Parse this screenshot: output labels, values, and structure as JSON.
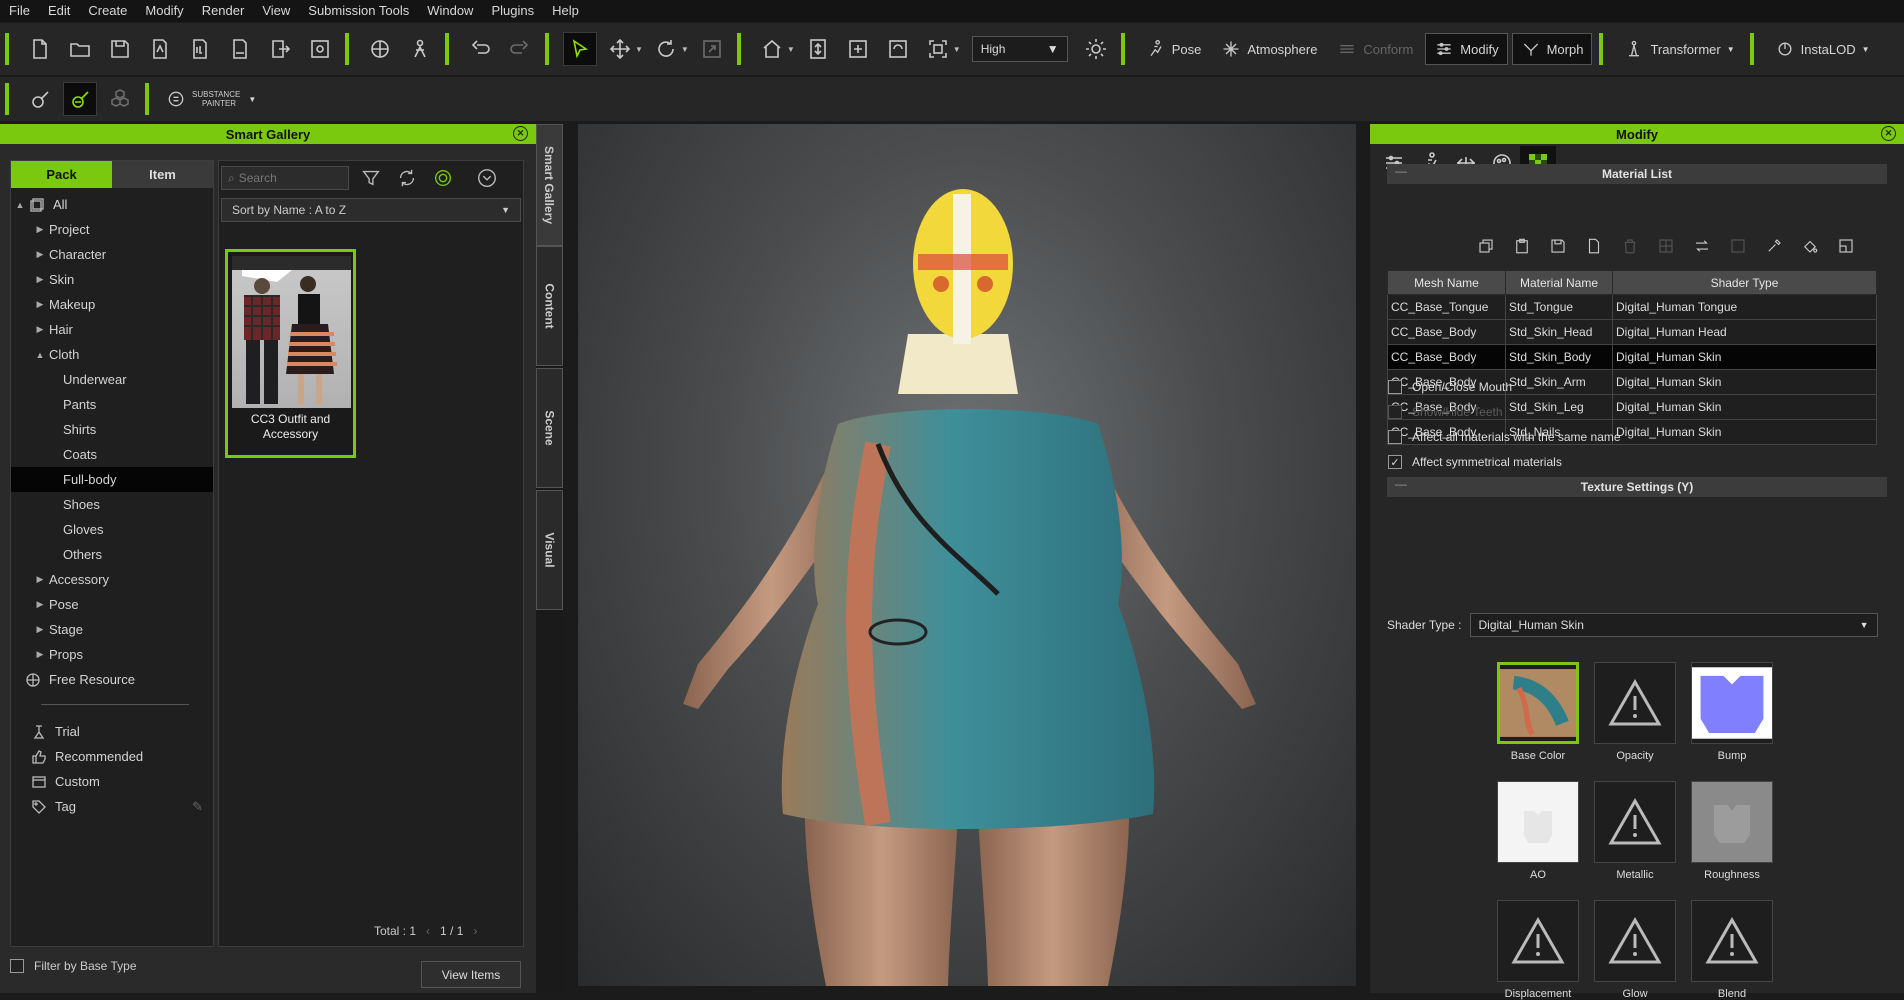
{
  "menu": [
    "File",
    "Edit",
    "Create",
    "Modify",
    "Render",
    "View",
    "Submission Tools",
    "Window",
    "Plugins",
    "Help"
  ],
  "toolbar": {
    "quality": "High",
    "pose_label": "Pose",
    "atmosphere_label": "Atmosphere",
    "conform_label": "Conform",
    "modify_label": "Modify",
    "morph_label": "Morph",
    "transformer_label": "Transformer",
    "instalod_label": "InstaLOD",
    "substance_label_1": "SUBSTANCE",
    "substance_label_2": "PAINTER"
  },
  "gallery": {
    "title": "Smart Gallery",
    "tabs": [
      "Pack",
      "Item"
    ],
    "tree": [
      {
        "label": "All",
        "level": 0,
        "arrow": "▲"
      },
      {
        "label": "Project",
        "level": 1,
        "arrow": "▶"
      },
      {
        "label": "Character",
        "level": 1,
        "arrow": "▶"
      },
      {
        "label": "Skin",
        "level": 1,
        "arrow": "▶"
      },
      {
        "label": "Makeup",
        "level": 1,
        "arrow": "▶"
      },
      {
        "label": "Hair",
        "level": 1,
        "arrow": "▶"
      },
      {
        "label": "Cloth",
        "level": 1,
        "arrow": "▲"
      },
      {
        "label": "Underwear",
        "level": 2,
        "arrow": ""
      },
      {
        "label": "Pants",
        "level": 2,
        "arrow": ""
      },
      {
        "label": "Shirts",
        "level": 2,
        "arrow": ""
      },
      {
        "label": "Coats",
        "level": 2,
        "arrow": ""
      },
      {
        "label": "Full-body",
        "level": 2,
        "arrow": "",
        "selected": true
      },
      {
        "label": "Shoes",
        "level": 2,
        "arrow": ""
      },
      {
        "label": "Gloves",
        "level": 2,
        "arrow": ""
      },
      {
        "label": "Others",
        "level": 2,
        "arrow": ""
      },
      {
        "label": "Accessory",
        "level": 1,
        "arrow": "▶"
      },
      {
        "label": "Pose",
        "level": 1,
        "arrow": "▶"
      },
      {
        "label": "Stage",
        "level": 1,
        "arrow": "▶"
      },
      {
        "label": "Props",
        "level": 1,
        "arrow": "▶"
      },
      {
        "label": "Free Resource",
        "level": 0,
        "arrow": ""
      }
    ],
    "collections": [
      "Trial",
      "Recommended",
      "Custom",
      "Tag"
    ],
    "search_placeholder": "Search",
    "sort": "Sort by Name : A to Z",
    "item_title": "CC3 Outfit and Accessory",
    "total": "Total : 1",
    "page": "1 / 1",
    "filter_label": "Filter by Base Type",
    "view_items": "View Items",
    "side_tabs": [
      "Smart Gallery",
      "Content",
      "Scene",
      "Visual"
    ]
  },
  "modify": {
    "title": "Modify",
    "material_list_title": "Material List",
    "columns": [
      "Mesh Name",
      "Material Name",
      "Shader Type"
    ],
    "rows": [
      [
        "CC_Base_Tongue",
        "Std_Tongue",
        "Digital_Human Tongue"
      ],
      [
        "CC_Base_Body",
        "Std_Skin_Head",
        "Digital_Human Head"
      ],
      [
        "CC_Base_Body",
        "Std_Skin_Body",
        "Digital_Human Skin"
      ],
      [
        "CC_Base_Body",
        "Std_Skin_Arm",
        "Digital_Human Skin"
      ],
      [
        "CC_Base_Body",
        "Std_Skin_Leg",
        "Digital_Human Skin"
      ],
      [
        "CC_Base_Body",
        "Std_Nails",
        "Digital_Human Skin"
      ]
    ],
    "selected_row": 2,
    "opt_mouth": "Open/Close Mouth",
    "opt_teeth": "Show/Hide Teeth",
    "opt_affect_all": "Affect all materials with the same name",
    "opt_symmetric": "Affect symmetrical materials",
    "texture_settings_title": "Texture Settings  (Y)",
    "shader_type_label": "Shader Type :",
    "shader_type_value": "Digital_Human Skin",
    "textures": [
      "Base Color",
      "Opacity",
      "Bump",
      "AO",
      "Metallic",
      "Roughness",
      "Displacement",
      "Glow",
      "Blend"
    ]
  },
  "colors": {
    "accent": "#7ac90e",
    "panel": "#262626",
    "dark": "#1f1f1f"
  }
}
